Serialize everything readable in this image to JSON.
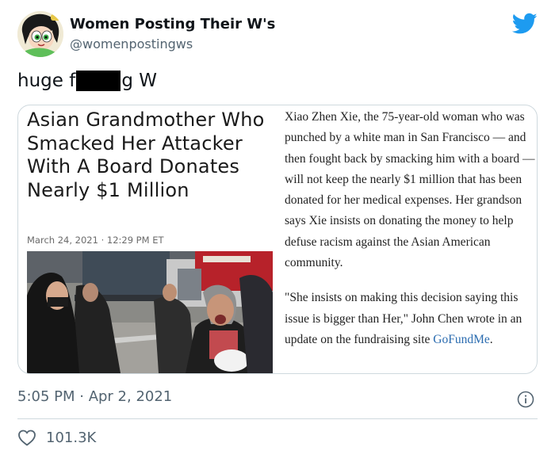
{
  "author": {
    "name": "Women Posting Their W's",
    "handle": "@womenpostingws",
    "avatar_icon": "powerpuff-character-avatar"
  },
  "tweet": {
    "text_before": "huge f",
    "text_after": "g W",
    "redaction": "redacted-word"
  },
  "card": {
    "headline": "Asian Grandmother Who Smacked Her Attacker With A Board Donates Nearly $1 Million",
    "dateline": "March 24, 2021 · 12:29 PM ET",
    "article": {
      "paragraph1": "Xiao Zhen Xie, the 75-year-old woman who was punched by a white man in San Francisco — and then fought back by smacking him with a board — will not keep the nearly $1 million that has been donated for her medical expenses. Her grandson says Xie insists on donating the money to help defuse racism against the Asian American community.",
      "paragraph2_text": "\"She insists on making this decision saying this issue is bigger than Her,\" John Chen wrote in an update on the fundraising site ",
      "paragraph2_link": "GoFundMe",
      "paragraph2_end": "."
    }
  },
  "footer": {
    "timestamp": "5:05 PM · Apr 2, 2021",
    "likes": "101.3K",
    "info_icon": "info-icon",
    "heart_icon": "heart-icon"
  },
  "colors": {
    "brand_twitter": "#1d9bf0",
    "muted_text": "#536471",
    "border": "#cfd9de",
    "link": "#2b6cb0"
  }
}
